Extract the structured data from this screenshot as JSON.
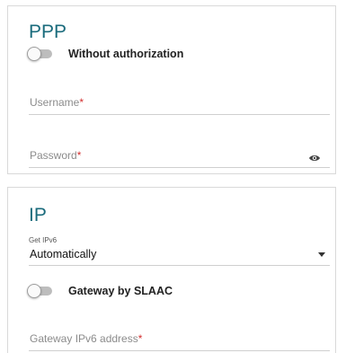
{
  "ppp": {
    "title": "PPP",
    "without_auth_toggle": {
      "label": "Without authorization",
      "on": false
    },
    "username": {
      "placeholder": "Username",
      "required_mark": "*",
      "value": ""
    },
    "password": {
      "placeholder": "Password",
      "required_mark": "*",
      "value": "",
      "icon": "eye-icon"
    }
  },
  "ip": {
    "title": "IP",
    "get_ipv6": {
      "label": "Get IPv6",
      "value": "Automatically"
    },
    "gateway_slaac_toggle": {
      "label": "Gateway by SLAAC",
      "on": false
    },
    "gateway_ipv6": {
      "placeholder": "Gateway IPv6 address",
      "required_mark": "*",
      "value": ""
    }
  },
  "colors": {
    "accent": "#1a6b7c",
    "required": "#d32f2f"
  }
}
